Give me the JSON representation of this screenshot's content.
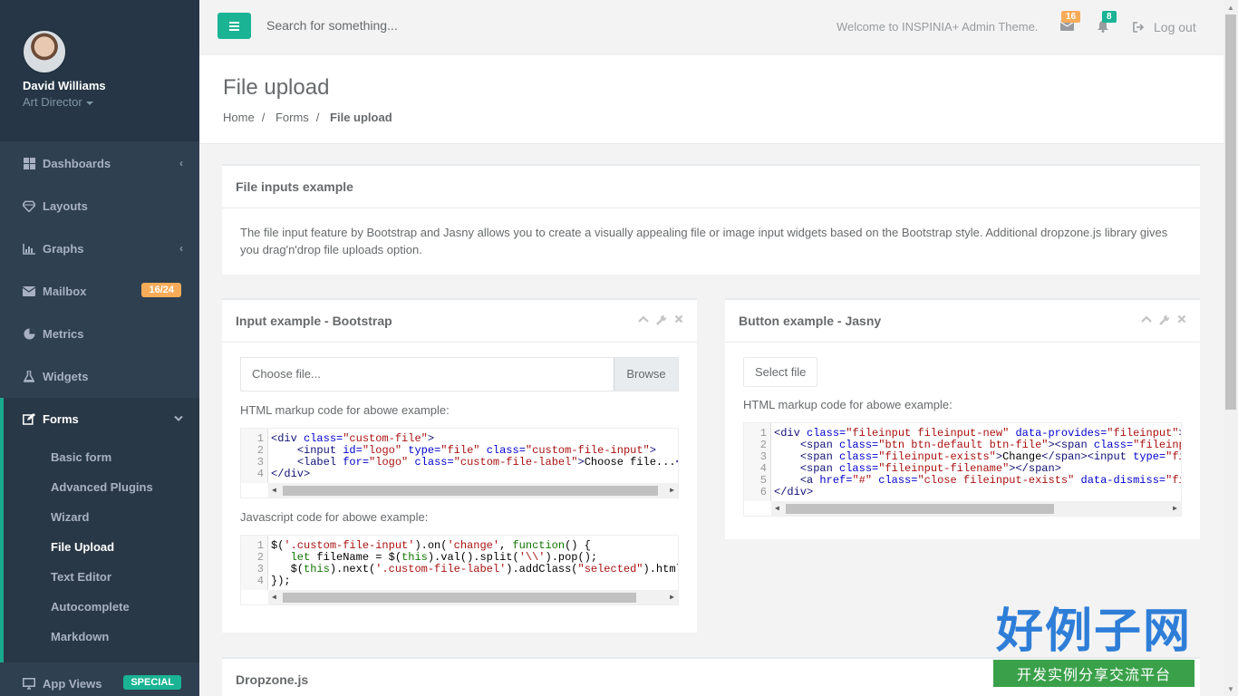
{
  "profile": {
    "name": "David Williams",
    "role": "Art Director"
  },
  "nav": [
    {
      "label": "Dashboards",
      "icon": "th-large-icon",
      "arrow": "‹"
    },
    {
      "label": "Layouts",
      "icon": "diamond-icon"
    },
    {
      "label": "Graphs",
      "icon": "bar-chart-icon",
      "arrow": "‹"
    },
    {
      "label": "Mailbox",
      "icon": "envelope-icon",
      "badge": "16/24"
    },
    {
      "label": "Metrics",
      "icon": "pie-chart-icon"
    },
    {
      "label": "Widgets",
      "icon": "flask-icon"
    }
  ],
  "forms": {
    "label": "Forms",
    "items": [
      "Basic form",
      "Advanced Plugins",
      "Wizard",
      "File Upload",
      "Text Editor",
      "Autocomplete",
      "Markdown"
    ],
    "active": "File Upload"
  },
  "app_views": {
    "label": "App Views",
    "badge": "SPECIAL"
  },
  "topbar": {
    "search_placeholder": "Search for something...",
    "welcome": "Welcome to INSPINIA+ Admin Theme.",
    "mail_count": "16",
    "alert_count": "8",
    "logout": "Log out"
  },
  "heading": {
    "title": "File upload",
    "crumbs": [
      "Home",
      "Forms",
      "File upload"
    ]
  },
  "intro": {
    "title": "File inputs example",
    "text": "The file input feature by Bootstrap and Jasny allows you to create a visually appealing file or image input widgets based on the Bootstrap style. Additional dropzone.js library gives you drag'n'drop file uploads option."
  },
  "bootstrap_box": {
    "title": "Input example - Bootstrap",
    "file_label": "Choose file...",
    "browse": "Browse",
    "html_caption": "HTML markup code for abowe example:",
    "js_caption": "Javascript code for abowe example:"
  },
  "jasny_box": {
    "title": "Button example - Jasny",
    "select_file": "Select file",
    "html_caption": "HTML markup code for abowe example:"
  },
  "dropzone": {
    "title": "Dropzone.js"
  },
  "watermark": {
    "big": "好例子网",
    "small": "开发实例分享交流平台"
  },
  "colors": {
    "sidebar": "#2f4050",
    "accent": "#1ab394",
    "warning": "#f8ac59"
  }
}
